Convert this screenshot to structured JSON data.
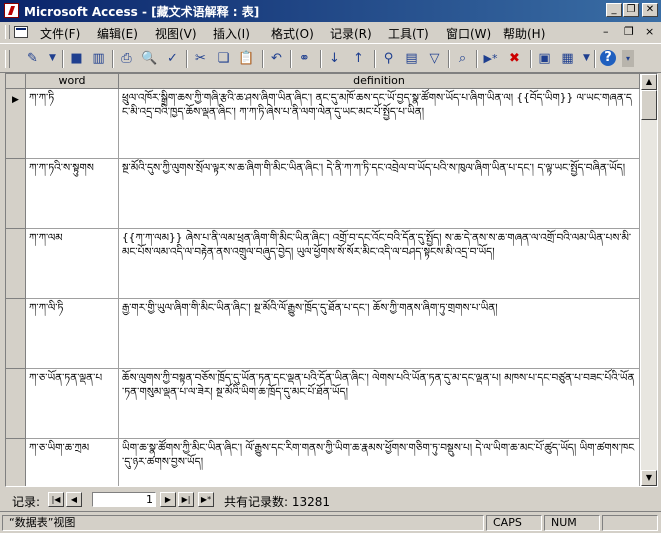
{
  "window": {
    "title": "Microsoft Access - [藏文术语解释 : 表]",
    "minimize_glyph": "_",
    "restore_glyph": "❐",
    "close_glyph": "✕"
  },
  "menubar": {
    "items": [
      "文件(F)",
      "编辑(E)",
      "视图(V)",
      "插入(I)",
      "格式(O)",
      "记录(R)",
      "工具(T)",
      "窗口(W)",
      "帮助(H)"
    ],
    "right_controls": [
      "–",
      "❐",
      "×"
    ]
  },
  "toolbar": {
    "buttons": [
      {
        "icon": "design-view-icon",
        "glyph": "✎"
      },
      {
        "icon": "save-icon",
        "glyph": "■"
      },
      {
        "icon": "print-icon",
        "glyph": "⎙"
      },
      {
        "icon": "print-preview-icon",
        "glyph": "🔍"
      },
      {
        "icon": "spelling-icon",
        "glyph": "✓"
      },
      {
        "icon": "cut-icon",
        "glyph": "✂"
      },
      {
        "icon": "copy-icon",
        "glyph": "❏"
      },
      {
        "icon": "paste-icon",
        "glyph": "📋"
      },
      {
        "icon": "undo-icon",
        "glyph": "↶"
      },
      {
        "icon": "hyperlink-icon",
        "glyph": "⚭"
      },
      {
        "icon": "sort-ascending-icon",
        "glyph": "↓"
      },
      {
        "icon": "sort-descending-icon",
        "glyph": "↑"
      },
      {
        "icon": "filter-by-selection-icon",
        "glyph": "⚲"
      },
      {
        "icon": "filter-by-form-icon",
        "glyph": "▤"
      },
      {
        "icon": "apply-filter-icon",
        "glyph": "▽"
      },
      {
        "icon": "find-icon",
        "glyph": "⌕"
      },
      {
        "icon": "new-record-icon",
        "glyph": "▶*"
      },
      {
        "icon": "delete-record-icon",
        "glyph": "✖"
      },
      {
        "icon": "database-window-icon",
        "glyph": "▣"
      },
      {
        "icon": "new-object-icon",
        "glyph": "▦"
      },
      {
        "icon": "help-icon",
        "glyph": "?"
      }
    ]
  },
  "datasheet": {
    "columns": [
      "word",
      "definition"
    ],
    "rows": [
      {
        "word": "ཀ་ཀ་ཏི",
        "definition": "ཕྲུལ་འཁོར་སྒྲིག་ཆས་ཀྱི་གཞི་རྩའི་ཆ་ཤས་ཞིག་ཡིན་ཞིང་། ནང་དུ་མཁོ་ཆས་དང་ཡོ་བྱད་སྣ་ཚོགས་ཡོད་པ་ཞིག་ཡིན་ལ། {{བོད་ཡིག}} ལ་ཡང་གཞན་དང་མི་འདྲ་བའི་ཁྱད་ཆོས་ལྡན་ཞིང་། ཀ་ཀ་ཏི་ཞེས་པ་ནི་ལག་ལེན་དུ་ཡང་མང་པོ་སྤྱོད་པ་ཡིན།"
      },
      {
        "word": "ཀ་ཀ་ཏའི་ས་སྟུགས",
        "definition": "སྔ་མོའི་དུས་ཀྱི་ལུགས་སྲོལ་ལྟར་ས་ཆ་ཞིག་གི་མིང་ཡིན་ཞིང་། དེ་ནི་ཀ་ཀ་ཏི་དང་འབྲེལ་བ་ཡོད་པའི་ས་ཁུལ་ཞིག་ཡིན་པ་དང་། ད་ལྟ་ཡང་སྤྱོད་བཞིན་ཡོད།"
      },
      {
        "word": "ཀ་ཀ་ལམ",
        "definition": "{{ཀ་ཀ་ལམ}} ཞེས་པ་ནི་ལམ་ཕྲན་ཞིག་གི་མིང་ཡིན་ཞིང་། འགྲོ་བ་དང་འོང་བའི་དོན་དུ་སྤྱོད། ས་ཆ་དེ་ནས་ས་ཆ་གཞན་ལ་འགྲོ་བའི་ལམ་ཡིན་པས་མི་མང་པོས་ལམ་འདི་ལ་བརྟེན་ནས་འགྲུལ་བཞུད་བྱེད། ཡུལ་ཕྱོགས་སོ་སོར་མིང་འདི་ལ་བཤད་སྟངས་མི་འདྲ་བ་ཡོད།"
      },
      {
        "word": "ཀ་ཀ་ལི་ཏི",
        "definition": "རྒྱ་གར་གྱི་ཡུལ་ཞིག་གི་མིང་ཡིན་ཞིང་། སྔ་མོའི་ལོ་རྒྱུས་ཁྲོད་དུ་ཐོན་པ་དང་། ཆོས་ཀྱི་གནས་ཞིག་ཏུ་གྲགས་པ་ཡིན།"
      },
      {
        "word": "ཀ་ཅ་ཡོན་ཏན་ལྡན་པ",
        "definition": "ཆོས་ལུགས་ཀྱི་བསྟན་བཅོས་ཁྲོད་དུ་ཡོན་ཏན་དང་ལྡན་པའི་དོན་ཡིན་ཞིང་། ལེགས་པའི་ཡོན་ཏན་དུ་མ་དང་ལྡན་པ། མཁས་པ་དང་བཙུན་པ་བཟང་པོའི་ཡོན་ཏན་གསུམ་ལྡན་པ་ལ་ཟེར། སྔ་མོའི་ཡིག་ཆ་ཁྲོད་དུ་མང་པོ་ཐོན་ཡོད།"
      },
      {
        "word": "ཀ་ཅ་ཡིག་ཆ་ཀྲམ",
        "definition": "ཡིག་ཆ་སྣ་ཚོགས་ཀྱི་མིང་ཡིན་ཞིང་། ལོ་རྒྱུས་དང་རིག་གནས་ཀྱི་ཡིག་ཆ་རྣམས་ཕྱོགས་གཅིག་ཏུ་བསྡུས་པ། དེ་ལ་ཡིག་ཆ་མང་པོ་ཚུད་ཡོད། ཡིག་ཚགས་ཁང་དུ་ཉར་ཚགས་བྱས་ཡོད།"
      }
    ]
  },
  "navigation": {
    "label": "记录:",
    "current_record": "1",
    "total_text": "共有记录数: 13281",
    "first_glyph": "|◀",
    "prev_glyph": "◀",
    "next_glyph": "▶",
    "last_glyph": "▶|",
    "new_glyph": "▶*"
  },
  "status": {
    "view_text": "“数据表”视图",
    "caps": "CAPS",
    "num": "NUM"
  }
}
